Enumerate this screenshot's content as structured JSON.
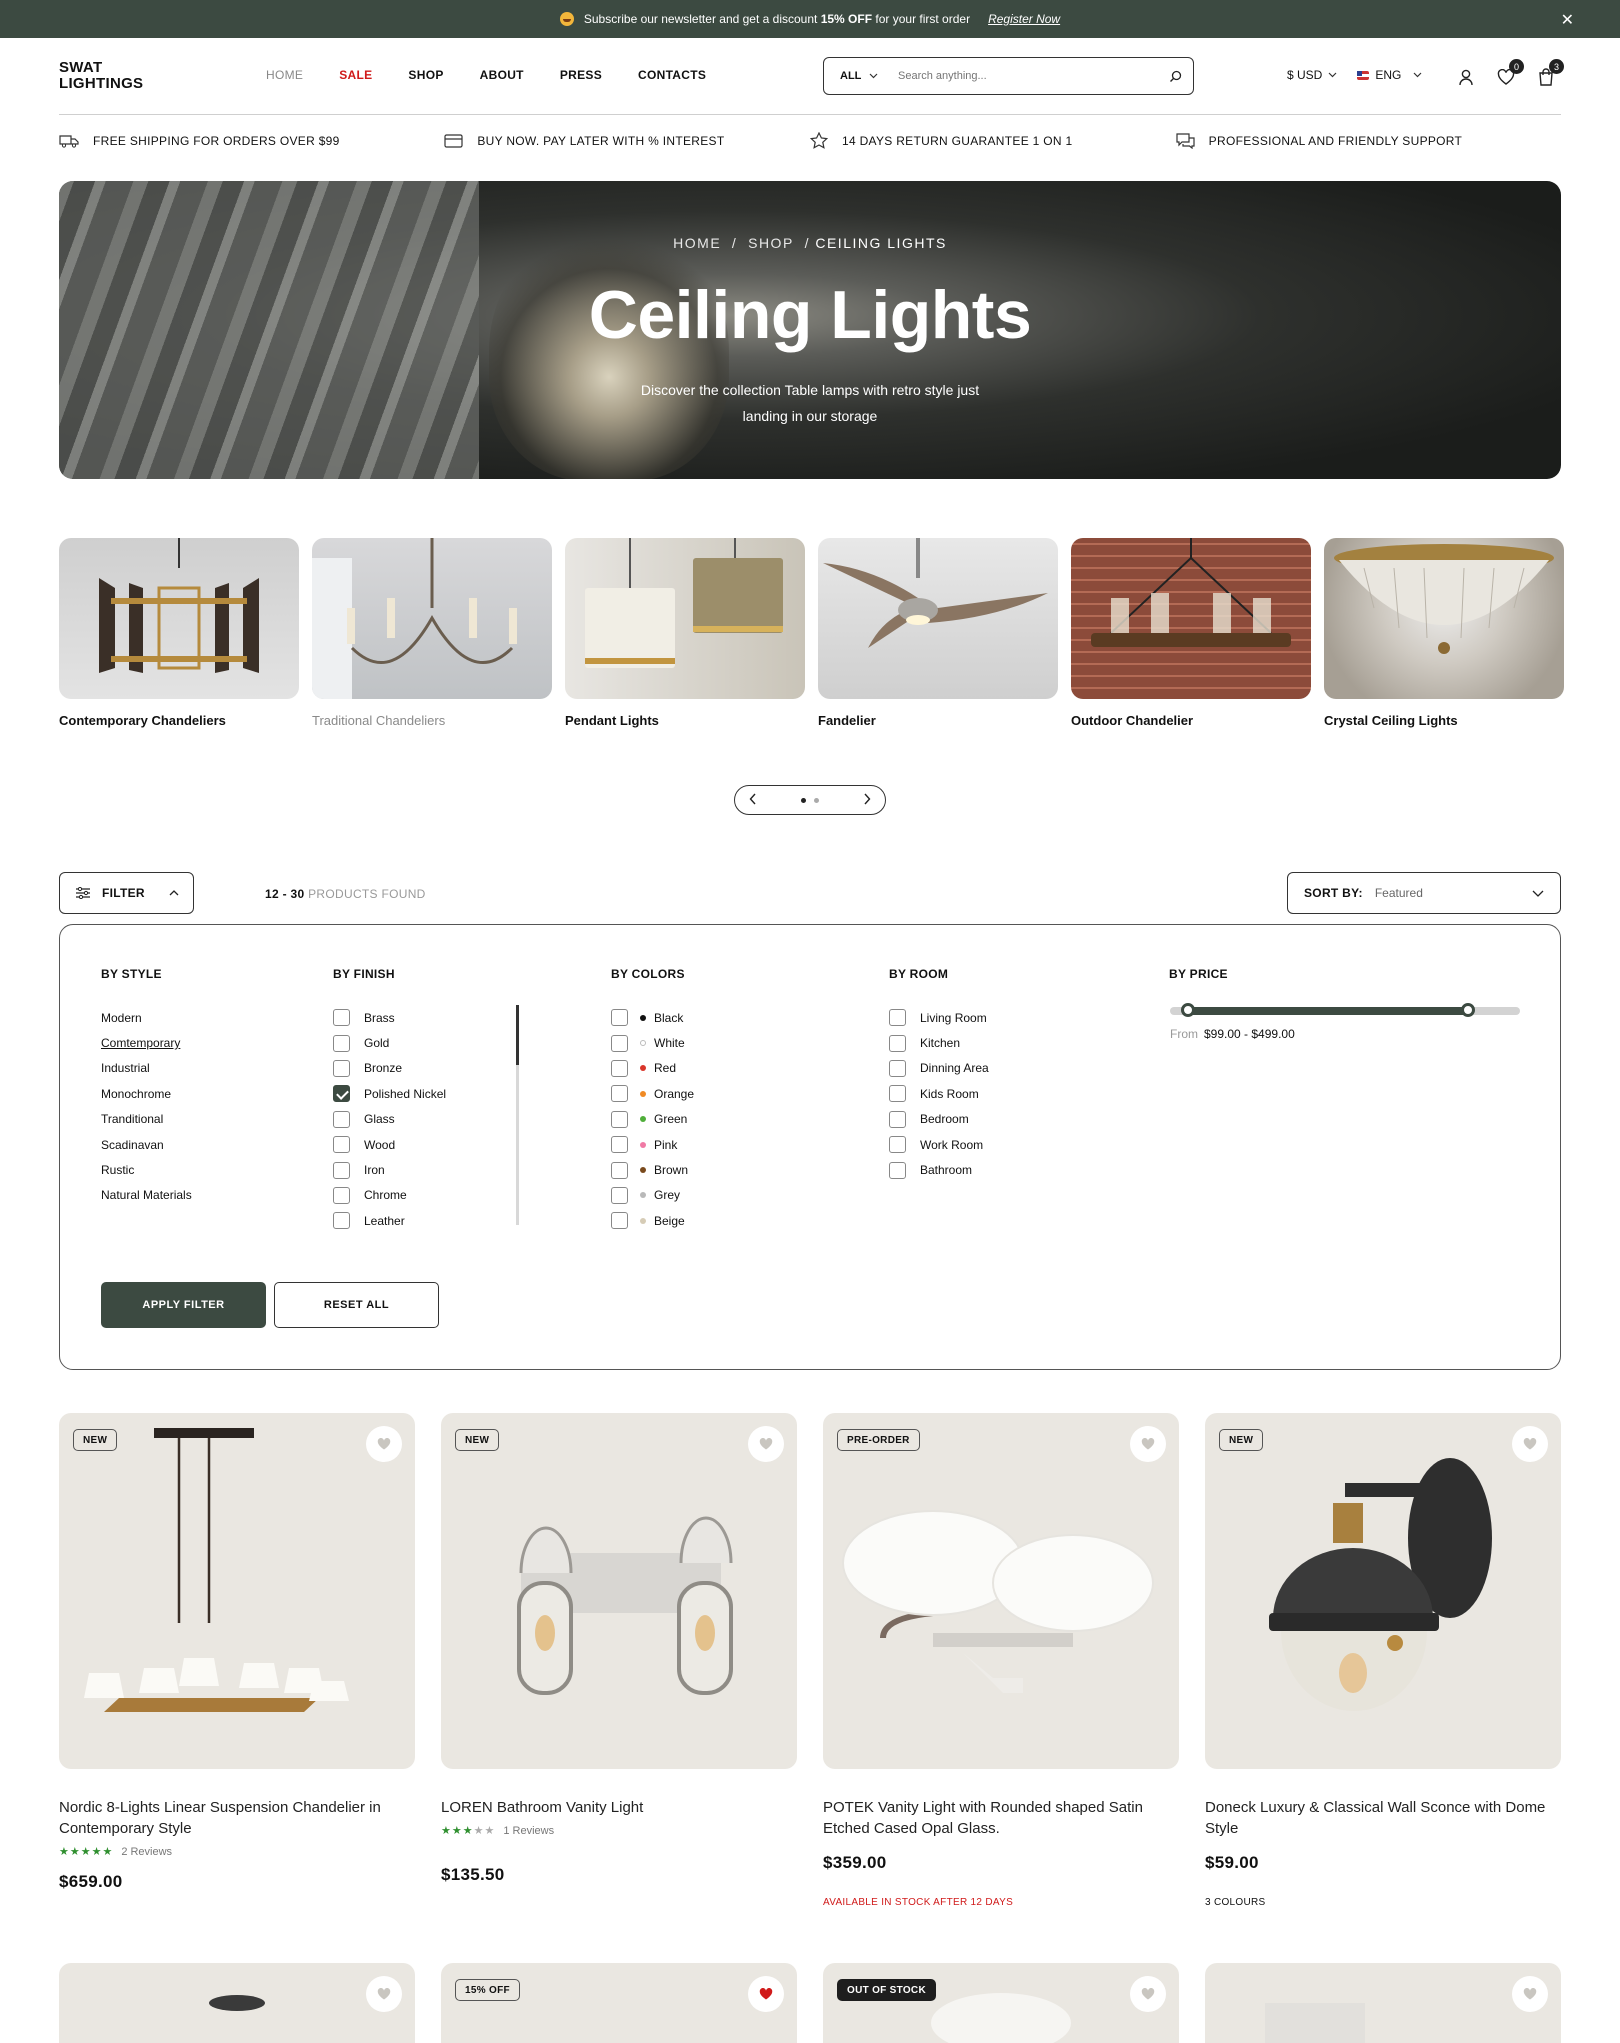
{
  "announcement": {
    "text_pre": "Subscribe our newsletter and get a discount ",
    "text_bold": "15% OFF",
    "text_post": " for your first order",
    "link": "Register Now"
  },
  "logo": {
    "line1": "SWAT",
    "line2": "LIGHTINGS"
  },
  "nav": [
    "HOME",
    "SALE",
    "SHOP",
    "ABOUT",
    "PRESS",
    "CONTACTS"
  ],
  "search": {
    "category": "ALL",
    "placeholder": "Search anything..."
  },
  "currency": "$ USD",
  "language": "ENG",
  "wishlist_count": "0",
  "cart_count": "3",
  "features": [
    "FREE SHIPPING FOR ORDERS OVER $99",
    "BUY NOW. PAY LATER WITH % INTEREST",
    "14 DAYS RETURN GUARANTEE 1 ON 1",
    "PROFESSIONAL AND FRIENDLY SUPPORT"
  ],
  "hero": {
    "breadcrumb": [
      "HOME",
      "SHOP",
      "CEILING LIGHTS"
    ],
    "title": "Ceiling Lights",
    "subtitle_line1": "Discover the collection Table lamps with retro style just",
    "subtitle_line2": "landing in our storage"
  },
  "categories": [
    "Contemporary Chandeliers",
    "Traditional Chandeliers",
    "Pendant Lights",
    "Fandelier",
    "Outdoor Chandelier",
    "Crystal Ceiling Lights"
  ],
  "toolbar": {
    "filter_label": "FILTER",
    "found_range": "12 - 30",
    "found_text": "PRODUCTS FOUND",
    "sort_label": "SORT BY:",
    "sort_value": "Featured"
  },
  "filters": {
    "style": {
      "title": "BY STYLE",
      "items": [
        "Modern",
        "Comtemporary",
        "Industrial",
        "Monochrome",
        "Tranditional",
        "Scadinavan",
        "Rustic",
        "Natural Materials"
      ]
    },
    "finish": {
      "title": "BY FINISH",
      "items": [
        "Brass",
        "Gold",
        "Bronze",
        "Polished Nickel",
        "Glass",
        "Wood",
        "Iron",
        "Chrome",
        "Leather"
      ]
    },
    "colors": {
      "title": "BY COLORS",
      "items": [
        {
          "name": "Black",
          "color": "#111111"
        },
        {
          "name": "White",
          "color": "#ffffff"
        },
        {
          "name": "Red",
          "color": "#d9352a"
        },
        {
          "name": "Orange",
          "color": "#f08a24"
        },
        {
          "name": "Green",
          "color": "#4fae3a"
        },
        {
          "name": "Pink",
          "color": "#f07aa5"
        },
        {
          "name": "Brown",
          "color": "#7a4a1d"
        },
        {
          "name": "Grey",
          "color": "#b9b9b9"
        },
        {
          "name": "Beige",
          "color": "#d6ccb6"
        }
      ]
    },
    "room": {
      "title": "BY ROOM",
      "items": [
        "Living Room",
        "Kitchen",
        "Dinning Area",
        "Kids Room",
        "Bedroom",
        "Work Room",
        "Bathroom"
      ]
    },
    "price": {
      "title": "BY PRICE",
      "from_label": "From",
      "range": "$99.00 - $499.00",
      "low_fraction": 0.05,
      "high_fraction": 0.85
    },
    "apply_label": "APPLY FILTER",
    "reset_label": "RESET ALL"
  },
  "products": [
    {
      "tag": "NEW",
      "name": "Nordic 8-Lights Linear Suspension Chandelier in Contemporary Style",
      "rating": 5,
      "reviews": "2 Reviews",
      "price": "$659.00",
      "note": ""
    },
    {
      "tag": "NEW",
      "name": "LOREN Bathroom Vanity Light",
      "rating": 3,
      "reviews": "1 Reviews",
      "price": "$135.50",
      "note": ""
    },
    {
      "tag": "PRE-ORDER",
      "name": "POTEK Vanity Light with Rounded shaped Satin Etched Cased Opal Glass.",
      "rating": 0,
      "reviews": "",
      "price": "$359.00",
      "note": "AVAILABLE IN STOCK AFTER 12 DAYS"
    },
    {
      "tag": "NEW",
      "name": "Doneck Luxury & Classical Wall Sconce with Dome Style",
      "rating": 0,
      "reviews": "",
      "price": "$59.00",
      "note": "3 COLOURS"
    }
  ],
  "row2_tags": [
    "",
    "15% OFF",
    "OUT OF STOCK",
    ""
  ],
  "colors": {
    "accent": "#3c4a41",
    "sale": "#d01a1a",
    "stars": "#2f8f2f"
  }
}
